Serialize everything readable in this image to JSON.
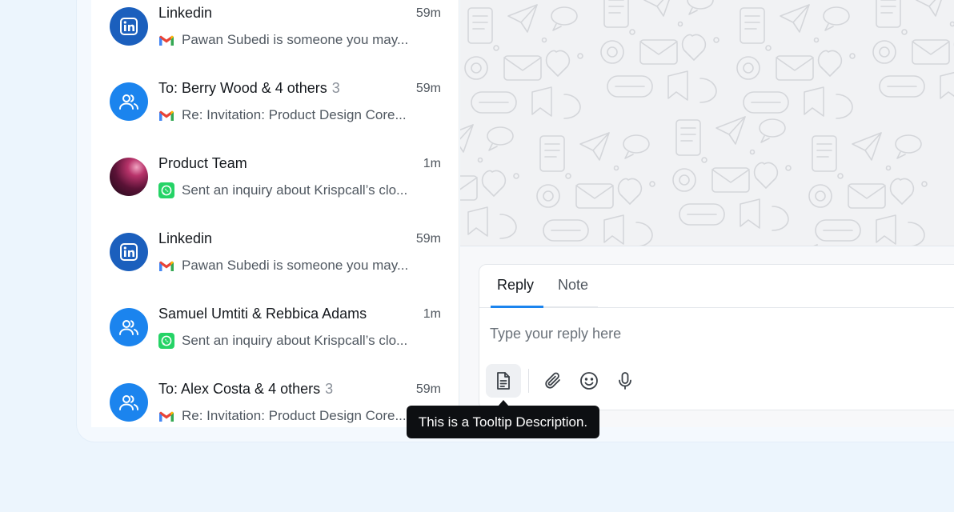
{
  "conversations": [
    {
      "name": "Linkedin",
      "count": "",
      "time": "59m",
      "channel": "gmail-icon",
      "preview": "Pawan Subedi is someone you may...",
      "avatar": "linkedin-icon"
    },
    {
      "name": "To: Berry Wood & 4 others",
      "count": "3",
      "time": "59m",
      "channel": "gmail-icon",
      "preview": "Re: Invitation: Product Design Core...",
      "avatar": "users-icon"
    },
    {
      "name": "Product Team",
      "count": "",
      "time": "1m",
      "channel": "whatsapp-icon",
      "preview": "Sent an inquiry about Krispcall’s clo...",
      "avatar": "photo"
    },
    {
      "name": "Linkedin",
      "count": "",
      "time": "59m",
      "channel": "gmail-icon",
      "preview": "Pawan Subedi is someone you may...",
      "avatar": "linkedin-icon"
    },
    {
      "name": "Samuel Umtiti & Rebbica Adams",
      "count": "",
      "time": "1m",
      "channel": "whatsapp-icon",
      "preview": "Sent an inquiry about Krispcall’s clo...",
      "avatar": "users-icon"
    },
    {
      "name": "To: Alex Costa & 4 others",
      "count": "3",
      "time": "59m",
      "channel": "gmail-icon",
      "preview": "Re: Invitation: Product Design Core...",
      "avatar": "users-icon"
    }
  ],
  "composer": {
    "tabs": [
      "Reply",
      "Note"
    ],
    "active_tab": "Reply",
    "placeholder": "Type your reply here",
    "tools": [
      "document-icon",
      "paperclip-icon",
      "emoji-icon",
      "microphone-icon"
    ]
  },
  "tooltip": {
    "text": "This is a Tooltip Description."
  },
  "colors": {
    "accent": "#1b84ee",
    "linkedin": "#1b5fbd",
    "whatsapp": "#25d366",
    "tooltip_bg": "#0d0f12"
  }
}
